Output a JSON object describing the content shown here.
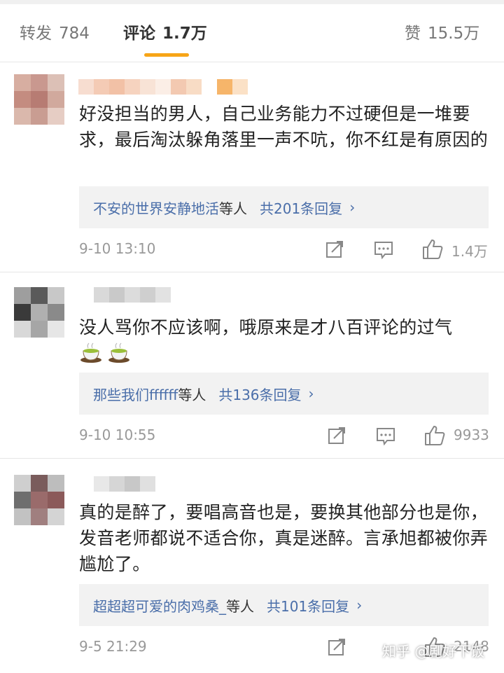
{
  "tabs": {
    "repost": {
      "label": "转发",
      "count": "784"
    },
    "comments": {
      "label": "评论",
      "count": "1.7万"
    },
    "likes": {
      "label": "赞",
      "count": "15.5万"
    }
  },
  "comments": [
    {
      "text": "好没担当的男人，自己业务能力不过硬但是一堆要求，最后淘汰躲角落里一声不吭，你不红是有原因的",
      "reply_users": "不安的世界安静地活",
      "reply_suffix": "等人",
      "reply_count": "共201条回复",
      "time": "9-10 13:10",
      "likes": "1.4万"
    },
    {
      "text": "没人骂你不应该啊，哦原来是才八百评论的过气",
      "emojis": [
        "tea-cup-icon",
        "tea-cup-icon"
      ],
      "reply_users": "那些我们ffffff",
      "reply_suffix": "等人",
      "reply_count": "共136条回复",
      "time": "9-10 10:55",
      "likes": "9933"
    },
    {
      "text": "真的是醉了，要唱高音也是，要换其他部分也是你，发音老师都说不适合你，真是迷醉。言承旭都被你弄尴尬了。",
      "reply_users": "超超超可爱的肉鸡桑_",
      "reply_suffix": "等人",
      "reply_count": "共101条回复",
      "time": "9-5 21:29",
      "likes": "2148"
    }
  ],
  "watermark": "知乎 @剧好下饭",
  "colors": {
    "tab_indicator": "#f7a517",
    "link_blue": "#4a6ea9",
    "reply_bg": "#f2f2f2",
    "meta_gray": "#999999"
  }
}
